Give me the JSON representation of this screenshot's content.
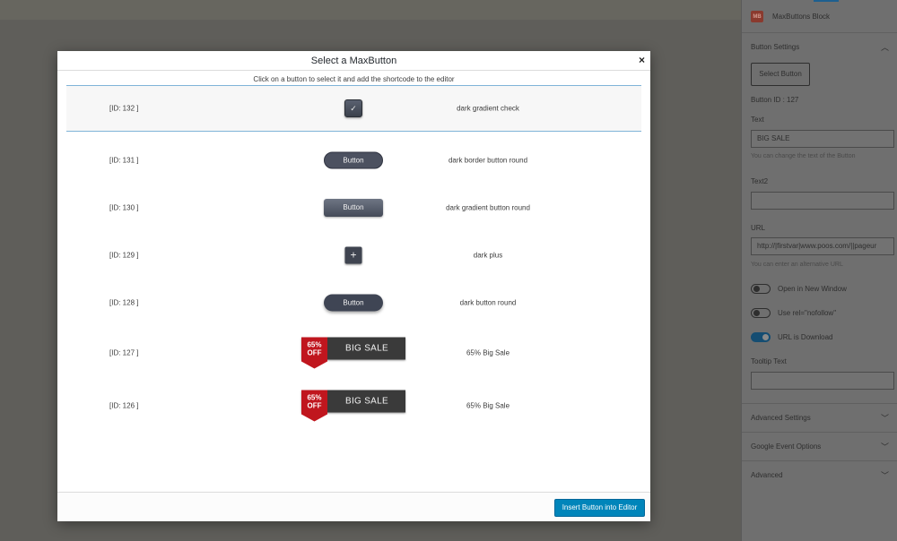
{
  "sidebar": {
    "block_icon_text": "MB",
    "block_title": "MaxButtons Block",
    "button_settings": {
      "title": "Button Settings",
      "select_label": "Select Button"
    },
    "button_id": "Button ID : 127",
    "text_label": "Text",
    "text_value": "BIG SALE",
    "text_help": "You can change the text of the Button",
    "text2_label": "Text2",
    "text2_value": "",
    "url_label": "URL",
    "url_value": "http://|firstvar|www.poos.com/||pageur",
    "url_help": "You can enter an alternative URL",
    "toggles": [
      {
        "label": "Open in New Window",
        "on": false
      },
      {
        "label": "Use rel=\"nofollow\"",
        "on": false
      },
      {
        "label": "URL is Download",
        "on": true
      }
    ],
    "tooltip_label": "Tooltip Text",
    "tooltip_value": "",
    "sections": [
      "Advanced Settings",
      "Google Event Options",
      "Advanced"
    ]
  },
  "modal": {
    "title": "Select a MaxButton",
    "close": "×",
    "subtitle": "Click on a button to select it and add the shortcode to the editor",
    "rows": [
      {
        "id": "[ID: 132 ]",
        "name": "dark gradient check",
        "button_glyph": "✓",
        "selected": true
      },
      {
        "id": "[ID: 131 ]",
        "name": "dark border button round",
        "button_label": "Button"
      },
      {
        "id": "[ID: 130 ]",
        "name": "dark gradient button round",
        "button_label": "Button"
      },
      {
        "id": "[ID: 129 ]",
        "name": "dark plus",
        "button_glyph": "+"
      },
      {
        "id": "[ID: 128 ]",
        "name": "dark button round",
        "button_label": "Button"
      },
      {
        "id": "[ID: 127 ]",
        "name": "65% Big Sale",
        "tag_line1": "65%",
        "tag_line2": "OFF",
        "button_label": "BIG SALE"
      },
      {
        "id": "[ID: 126 ]",
        "name": "65% Big Sale",
        "tag_line1": "65%",
        "tag_line2": "OFF",
        "button_label": "BIG SALE"
      }
    ],
    "insert_label": "Insert Button into Editor"
  },
  "colors": {
    "accent": "#0085ba",
    "sale_red": "#c0161e",
    "button_dark": "#3f4554"
  }
}
